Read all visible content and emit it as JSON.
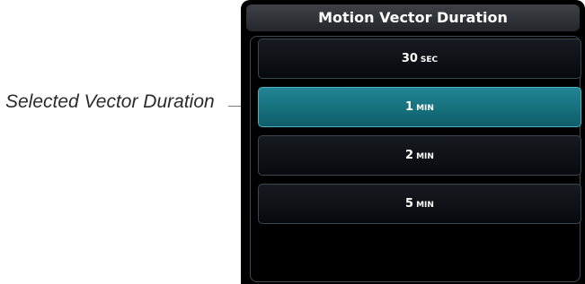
{
  "callout": {
    "label": "Selected Vector Duration"
  },
  "dialog": {
    "title": "Motion Vector Duration",
    "options": [
      {
        "value": "30",
        "unit": "SEC",
        "selected": false
      },
      {
        "value": "1",
        "unit": "MIN",
        "selected": true
      },
      {
        "value": "2",
        "unit": "MIN",
        "selected": false
      },
      {
        "value": "5",
        "unit": "MIN",
        "selected": false
      }
    ]
  },
  "colors": {
    "selected_bg": "#1a7c8a",
    "button_bg": "#0d1116",
    "panel_bg": "#000000"
  }
}
